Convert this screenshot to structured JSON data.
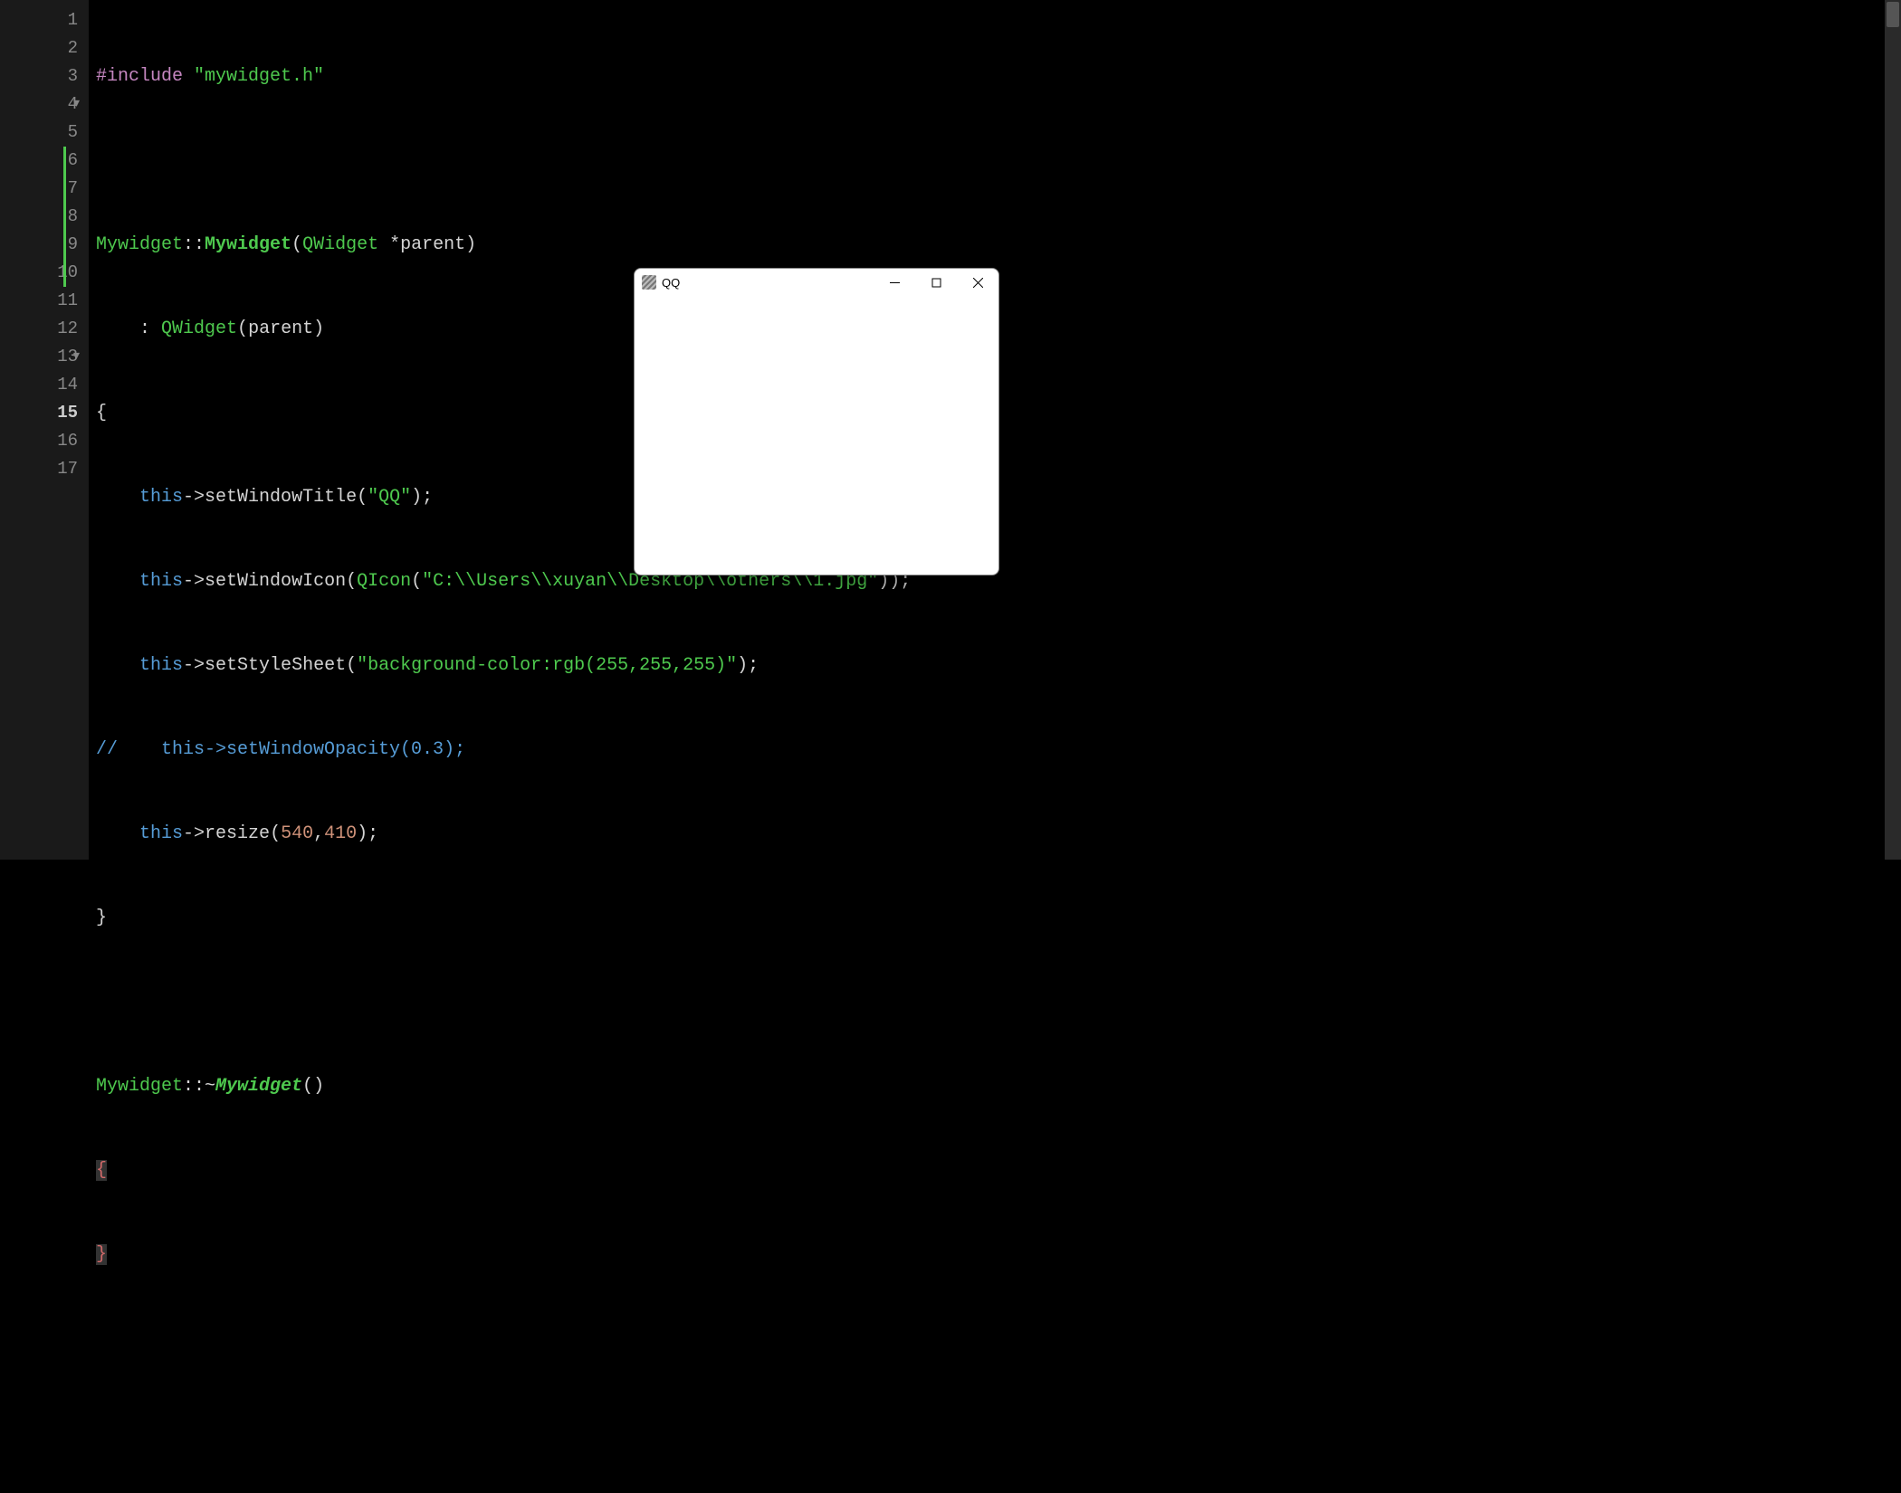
{
  "editor": {
    "line_numbers": [
      "1",
      "2",
      "3",
      "4",
      "5",
      "6",
      "7",
      "8",
      "9",
      "10",
      "11",
      "12",
      "13",
      "14",
      "15",
      "16",
      "17"
    ],
    "current_line": "15",
    "fold_lines": [
      4,
      13
    ],
    "change_bar_lines": [
      6,
      7,
      8,
      9,
      10
    ],
    "code": {
      "l1": {
        "include": "#include",
        "sp": " ",
        "path": "\"mywidget.h\""
      },
      "l3": {
        "cls": "Mywidget",
        "sep": "::",
        "fn": "Mywidget",
        "lp": "(",
        "type": "QWidget",
        "star": " *",
        "arg": "parent",
        "rp": ")"
      },
      "l4": {
        "indent": "    ",
        "colon": ": ",
        "ctor": "QWidget",
        "lp": "(",
        "arg": "parent",
        "rp": ")"
      },
      "l5": {
        "brace": "{"
      },
      "l6": {
        "indent": "    ",
        "this": "this",
        "arrow": "->",
        "method": "setWindowTitle",
        "lp": "(",
        "str": "\"QQ\"",
        "rp": ");"
      },
      "l7": {
        "indent": "    ",
        "this": "this",
        "arrow": "->",
        "method": "setWindowIcon",
        "lp": "(",
        "icon": "QIcon",
        "lp2": "(",
        "str": "\"C:\\\\Users\\\\xuyan\\\\Desktop\\\\others\\\\1.jpg\"",
        "rp": "));"
      },
      "l8": {
        "indent": "    ",
        "this": "this",
        "arrow": "->",
        "method": "setStyleSheet",
        "lp": "(",
        "str": "\"background-color:rgb(255,255,255)\"",
        "rp": ");"
      },
      "l9": {
        "comment": "//    this->setWindowOpacity(0.3);"
      },
      "l10": {
        "indent": "    ",
        "this": "this",
        "arrow": "->",
        "method": "resize",
        "lp": "(",
        "n1": "540",
        "comma": ",",
        "n2": "410",
        "rp": ");"
      },
      "l11": {
        "brace": "}"
      },
      "l13": {
        "cls": "Mywidget",
        "sep": "::~",
        "fn": "Mywidget",
        "lp": "(",
        "rp": ")"
      },
      "l14": {
        "brace": "{"
      },
      "l15": {
        "brace": "}"
      }
    }
  },
  "qt_window": {
    "title": "QQ"
  }
}
